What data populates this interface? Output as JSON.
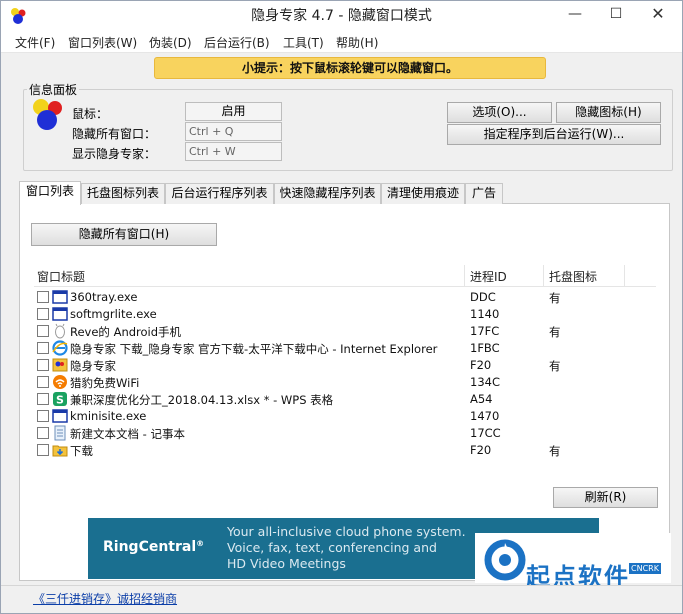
{
  "window": {
    "title": "隐身专家 4.7 - 隐藏窗口模式",
    "controls": {
      "minimize": "—",
      "maximize": "☐",
      "close": "✕"
    }
  },
  "menu": [
    "文件(F)",
    "窗口列表(W)",
    "伪装(D)",
    "后台运行(B)",
    "工具(T)",
    "帮助(H)"
  ],
  "tip": "小提示：按下鼠标滚轮键可以隐藏窗口。",
  "info_panel": {
    "legend": "信息面板",
    "rows": [
      {
        "label": "鼠标：",
        "value": "启用"
      },
      {
        "label": "隐藏所有窗口：",
        "value": "Ctrl + Q"
      },
      {
        "label": "显示隐身专家：",
        "value": "Ctrl + W"
      }
    ],
    "buttons": {
      "options": "选项(O)...",
      "hide_icon": "隐藏图标(H)",
      "assign_background": "指定程序到后台运行(W)..."
    }
  },
  "tabs": [
    "窗口列表",
    "托盘图标列表",
    "后台运行程序列表",
    "快速隐藏程序列表",
    "清理使用痕迹",
    "广告"
  ],
  "active_tab": 0,
  "hide_all_button": "隐藏所有窗口(H)",
  "table": {
    "columns": [
      "窗口标题",
      "进程ID",
      "托盘图标"
    ],
    "rows": [
      {
        "icon": "window-icon",
        "title": "360tray.exe",
        "pid": "DDC",
        "tray": "有"
      },
      {
        "icon": "window-icon",
        "title": "softmgrlite.exe",
        "pid": "1140",
        "tray": ""
      },
      {
        "icon": "android-icon",
        "title": "Reve的 Android手机",
        "pid": "17FC",
        "tray": "有"
      },
      {
        "icon": "ie-icon",
        "title": "隐身专家 下载_隐身专家 官方下载-太平洋下载中心 - Internet Explorer",
        "pid": "1FBC",
        "tray": ""
      },
      {
        "icon": "app-logo-icon",
        "title": "隐身专家",
        "pid": "F20",
        "tray": "有"
      },
      {
        "icon": "wifi-icon",
        "title": "猎豹免费WiFi",
        "pid": "134C",
        "tray": ""
      },
      {
        "icon": "wps-sheet-icon",
        "title": "兼职深度优化分工_2018.04.13.xlsx * - WPS 表格",
        "pid": "A54",
        "tray": ""
      },
      {
        "icon": "window-icon",
        "title": "kminisite.exe",
        "pid": "1470",
        "tray": ""
      },
      {
        "icon": "notepad-icon",
        "title": "新建文本文档 - 记事本",
        "pid": "17CC",
        "tray": ""
      },
      {
        "icon": "folder-download-icon",
        "title": "下载",
        "pid": "F20",
        "tray": "有"
      }
    ]
  },
  "refresh_button": "刷新(R)",
  "ad": {
    "brand": "RingCentral",
    "registered": "®",
    "lines": [
      "Your all-inclusive cloud phone system.",
      "Voice, fax, text, conferencing and",
      "HD Video Meetings"
    ]
  },
  "watermark": {
    "text": "起点软件",
    "tag": "CNCRK"
  },
  "status_link": "《三仟进销存》诚招经销商",
  "colors": {
    "tip_bg": "#f8d35e",
    "ad_bg": "#1a6f90",
    "link": "#0b3ea8",
    "watermark": "#1b72c4"
  }
}
